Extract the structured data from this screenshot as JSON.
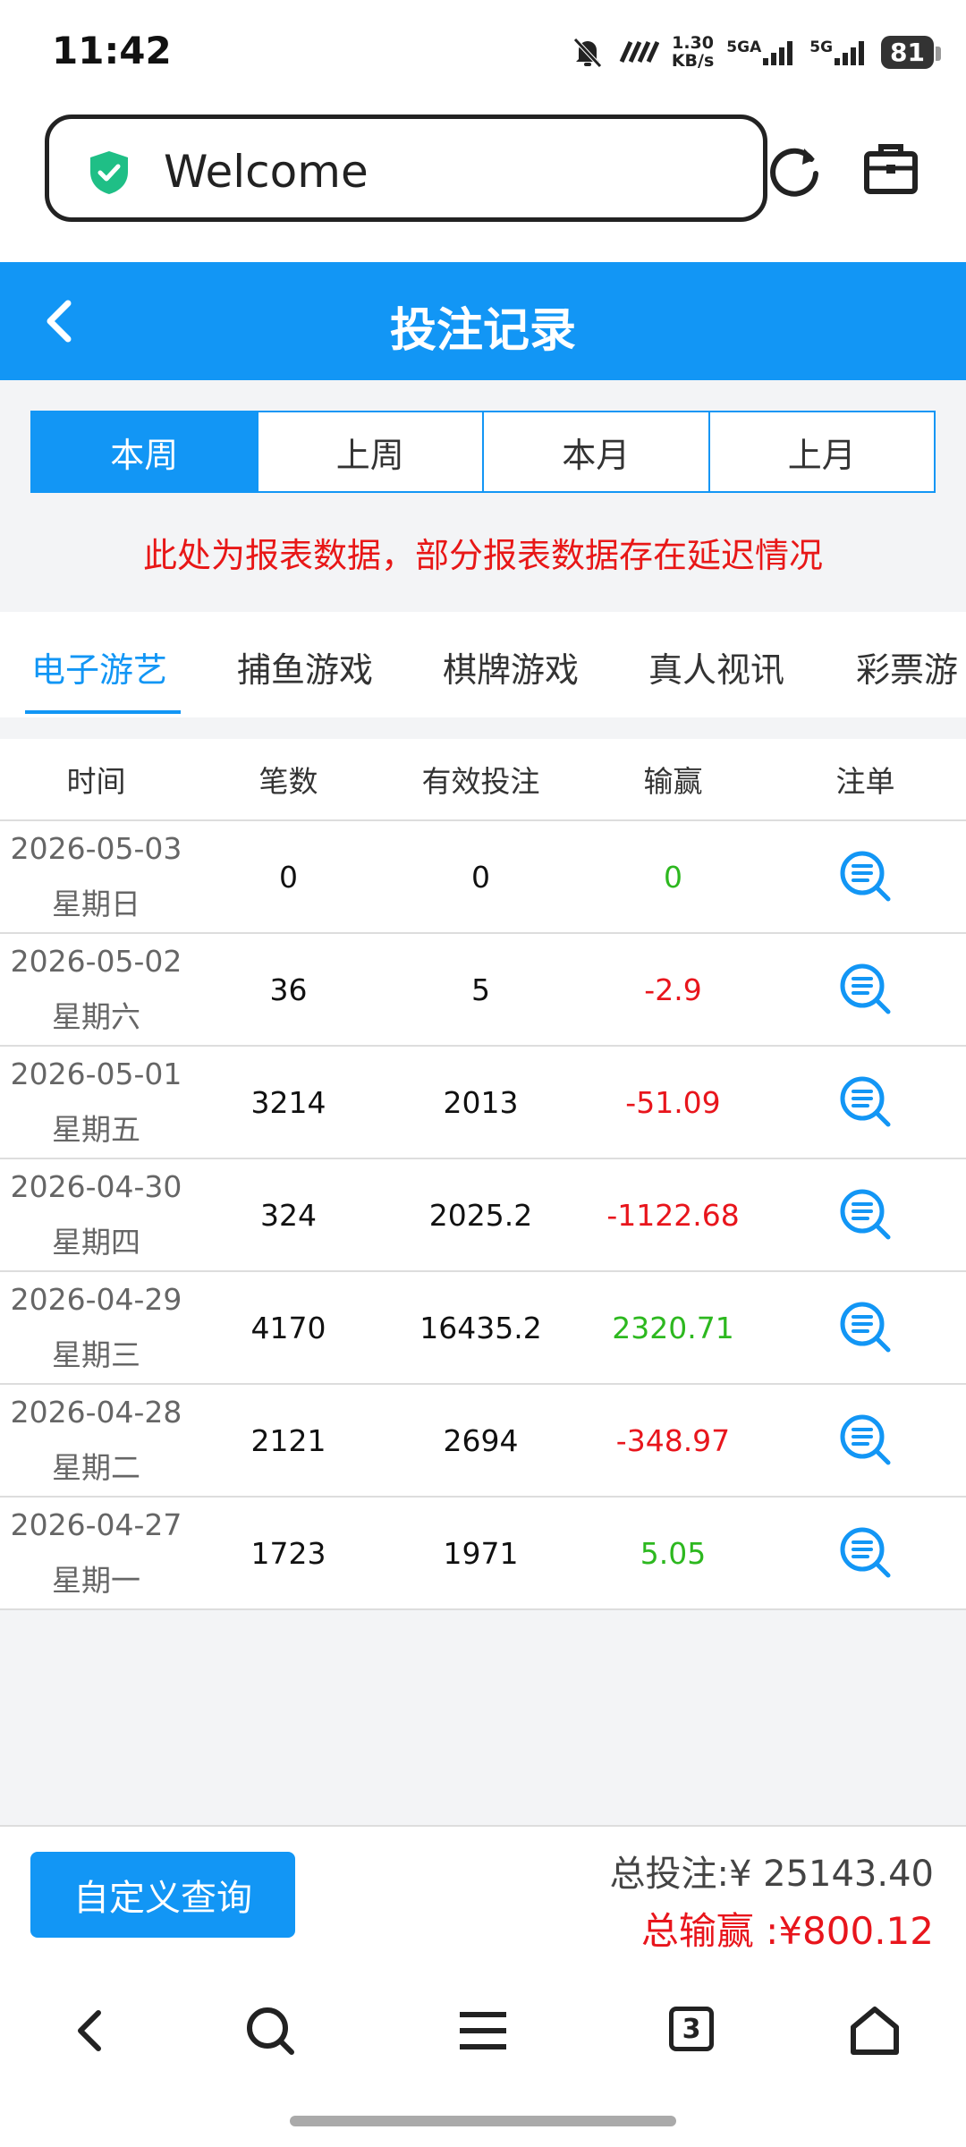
{
  "status_bar": {
    "time": "11:42",
    "net_speed_value": "1.30",
    "net_speed_unit": "KB/s",
    "signal1_label": "5GA",
    "signal2_label": "5G",
    "battery": "81"
  },
  "browser": {
    "url_text": "Welcome",
    "tab_count": "3"
  },
  "header": {
    "title": "投注记录"
  },
  "range_tabs": [
    {
      "label": "本周",
      "active": true
    },
    {
      "label": "上周",
      "active": false
    },
    {
      "label": "本月",
      "active": false
    },
    {
      "label": "上月",
      "active": false
    }
  ],
  "notice": "此处为报表数据，部分报表数据存在延迟情况",
  "game_tabs": [
    {
      "label": "电子游艺",
      "active": true
    },
    {
      "label": "捕鱼游戏",
      "active": false
    },
    {
      "label": "棋牌游戏",
      "active": false
    },
    {
      "label": "真人视讯",
      "active": false
    },
    {
      "label": "彩票游",
      "active": false
    }
  ],
  "table": {
    "headers": [
      "时间",
      "笔数",
      "有效投注",
      "输赢",
      "注单"
    ],
    "rows": [
      {
        "date": "2026-05-03",
        "weekday": "星期日",
        "count": "0",
        "valid_bet": "0",
        "win_loss": "0",
        "sign": "pos"
      },
      {
        "date": "2026-05-02",
        "weekday": "星期六",
        "count": "36",
        "valid_bet": "5",
        "win_loss": "-2.9",
        "sign": "neg"
      },
      {
        "date": "2026-05-01",
        "weekday": "星期五",
        "count": "3214",
        "valid_bet": "2013",
        "win_loss": "-51.09",
        "sign": "neg"
      },
      {
        "date": "2026-04-30",
        "weekday": "星期四",
        "count": "324",
        "valid_bet": "2025.2",
        "win_loss": "-1122.68",
        "sign": "neg"
      },
      {
        "date": "2026-04-29",
        "weekday": "星期三",
        "count": "4170",
        "valid_bet": "16435.2",
        "win_loss": "2320.71",
        "sign": "pos"
      },
      {
        "date": "2026-04-28",
        "weekday": "星期二",
        "count": "2121",
        "valid_bet": "2694",
        "win_loss": "-348.97",
        "sign": "neg"
      },
      {
        "date": "2026-04-27",
        "weekday": "星期一",
        "count": "1723",
        "valid_bet": "1971",
        "win_loss": "5.05",
        "sign": "pos"
      }
    ]
  },
  "footer": {
    "custom_query_label": "自定义查询",
    "total_bet": "总投注:¥ 25143.40",
    "total_win": "总输赢 :¥800.12"
  },
  "colors": {
    "accent": "#1296f5",
    "negative": "#e8151c",
    "positive": "#2db81f"
  },
  "icons": {
    "detail": "search-list-icon",
    "shield": "shield-check-icon"
  }
}
